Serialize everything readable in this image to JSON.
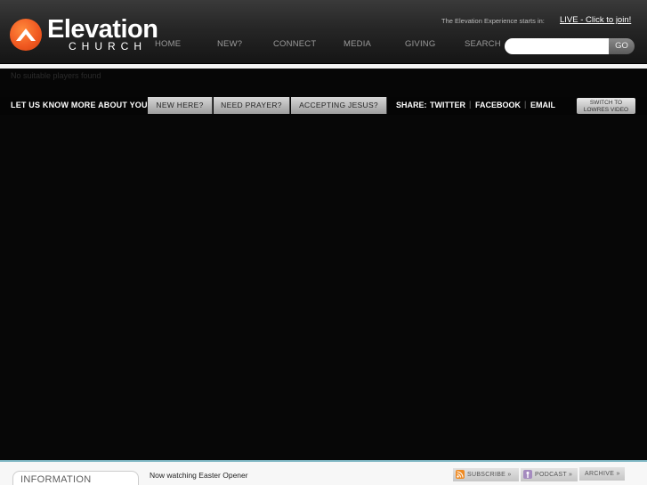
{
  "brand": {
    "name": "Elevation",
    "sub": "CHURCH",
    "accent": "#f15a22"
  },
  "header": {
    "experience_text": "The Elevation Experience starts in:",
    "live_link": "LIVE - Click to join!"
  },
  "nav": {
    "items": [
      {
        "label": "HOME"
      },
      {
        "label": "NEW?"
      },
      {
        "label": "CONNECT"
      },
      {
        "label": "MEDIA"
      },
      {
        "label": "GIVING"
      },
      {
        "label": "SEARCH"
      }
    ]
  },
  "search": {
    "value": "",
    "go_label": "GO"
  },
  "player": {
    "message": "No suitable players found"
  },
  "action_bar": {
    "prompt": "LET US KNOW MORE ABOUT YOU:",
    "buttons": [
      {
        "label": "NEW HERE?"
      },
      {
        "label": "NEED PRAYER?"
      },
      {
        "label": "ACCEPTING JESUS?"
      }
    ],
    "share_label": "SHARE:",
    "share_links": [
      {
        "label": "TWITTER"
      },
      {
        "label": "FACEBOOK"
      },
      {
        "label": "EMAIL"
      }
    ],
    "switch_line1": "SWITCH TO",
    "switch_line2": "LOWRES VIDEO"
  },
  "footer": {
    "info_tab": "INFORMATION",
    "now_watching_prefix": "Now watching",
    "now_watching_title": "Easter Opener",
    "subscribe": "SUBSCRIBE »",
    "podcast": "PODCAST »",
    "archive": "ARCHIVE »",
    "icons": [
      "rss-icon",
      "podcast-icon"
    ]
  }
}
